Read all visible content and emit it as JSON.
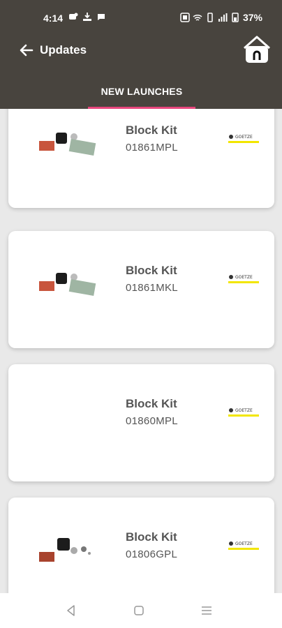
{
  "status_bar": {
    "time": "4:14",
    "battery": "37%"
  },
  "app_bar": {
    "title": "Updates",
    "back_icon": "arrow-left-icon",
    "home_icon": "home-icon"
  },
  "tab": {
    "label": "NEW LAUNCHES",
    "indicator_color": "#e8467c"
  },
  "products": [
    {
      "name": "Block Kit",
      "code": "01861MPL",
      "brand": "GOETZE",
      "has_image": true
    },
    {
      "name": "Block Kit",
      "code": "01861MKL",
      "brand": "GOETZE",
      "has_image": true
    },
    {
      "name": "Block Kit",
      "code": "01860MPL",
      "brand": "GOETZE",
      "has_image": false
    },
    {
      "name": "Block Kit",
      "code": "01806GPL",
      "brand": "GOETZE",
      "has_image": true
    }
  ],
  "colors": {
    "header_bg": "#48443e",
    "page_bg": "#e9e9e9",
    "brand_yellow": "#f2e600"
  }
}
